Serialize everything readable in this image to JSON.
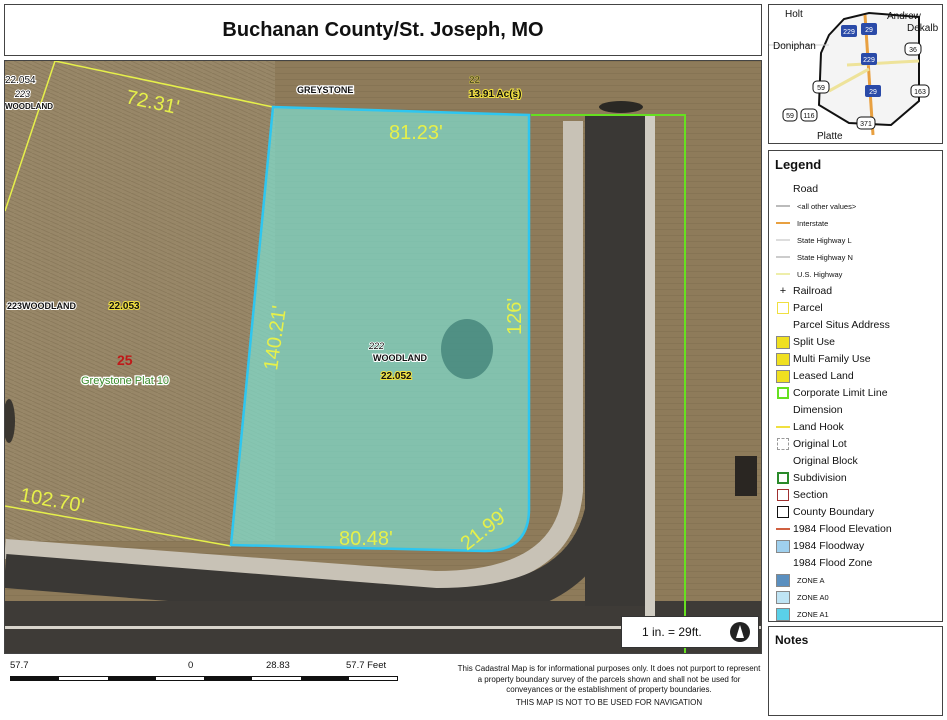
{
  "title": "Buchanan County/St. Joseph, MO",
  "map": {
    "labels": {
      "greystone": "GREYSTONE",
      "top_parcel_num": "22",
      "top_parcel_area": "13.91 Ac(s)",
      "left_top_id": "22.054",
      "left_top_num": "223",
      "left_top_street": "WOODLAND",
      "left_mid_addr": "223WOODLAND",
      "left_mid_id": "22.053",
      "section_num": "25",
      "plat": "Greystone Plat 10",
      "parcel_num": "222",
      "parcel_street": "WOODLAND",
      "parcel_id": "22.052"
    },
    "dimensions": {
      "top": "81.23'",
      "left": "140.21'",
      "right": "126'",
      "bottom": "80.48'",
      "corner": "21.99'",
      "top_left": "72.31'",
      "bottom_left": "102.70'"
    },
    "colors": {
      "selected_parcel": "#7fe0d0",
      "selected_outline": "#2ec6f0",
      "dimension_text": "#e6f04a",
      "limit_line": "#66e020"
    }
  },
  "scale": {
    "text": "1 in. = 29ft.",
    "north_icon": "north-arrow-icon"
  },
  "scalebar": {
    "labels": [
      "57.7",
      "0",
      "28.83",
      "57.7 Feet"
    ]
  },
  "disclaimer": {
    "text": "This Cadastral Map is for informational purposes only.  It does not purport to represent a property boundary survey of the parcels shown and shall not be used for conveyances or the establishment of property boundaries.",
    "warning": "THIS MAP IS NOT TO BE USED FOR NAVIGATION"
  },
  "inset": {
    "places": [
      "Holt",
      "Andrew",
      "Dekalb",
      "Doniphan",
      "Platte"
    ],
    "shields": [
      "229",
      "29",
      "36",
      "229",
      "59",
      "29",
      "163",
      "59",
      "116",
      "371"
    ]
  },
  "legend": {
    "title": "Legend",
    "items": [
      {
        "label": "Road",
        "symbol": "none",
        "color": ""
      },
      {
        "label": "<all other values>",
        "symbol": "line",
        "color": "#bbbbbb",
        "small": true
      },
      {
        "label": "Interstate",
        "symbol": "line",
        "color": "#e8a040",
        "small": true
      },
      {
        "label": "State Highway L",
        "symbol": "line",
        "color": "#dddddd",
        "small": true
      },
      {
        "label": "State Highway N",
        "symbol": "line",
        "color": "#cccccc",
        "small": true
      },
      {
        "label": "U.S. Highway",
        "symbol": "line",
        "color": "#eeeeaa",
        "small": true
      },
      {
        "label": "Railroad",
        "symbol": "rail",
        "color": "#111111"
      },
      {
        "label": "Parcel",
        "symbol": "outline",
        "color": "#f0e040"
      },
      {
        "label": "Parcel Situs Address",
        "symbol": "none",
        "color": ""
      },
      {
        "label": "Split Use",
        "symbol": "fill",
        "color": "#f0e020"
      },
      {
        "label": "Multi Family Use",
        "symbol": "fill",
        "color": "#f0e020"
      },
      {
        "label": "Leased Land",
        "symbol": "fill",
        "color": "#f0e020"
      },
      {
        "label": "Corporate Limit Line",
        "symbol": "outline-thick",
        "color": "#66e020"
      },
      {
        "label": "Dimension",
        "symbol": "none",
        "color": ""
      },
      {
        "label": "Land Hook",
        "symbol": "line",
        "color": "#f0e040"
      },
      {
        "label": "Original Lot",
        "symbol": "dashed",
        "color": "#999999"
      },
      {
        "label": "Original Block",
        "symbol": "none",
        "color": ""
      },
      {
        "label": "Subdivision",
        "symbol": "outline-thick",
        "color": "#2a8a2a"
      },
      {
        "label": "Section",
        "symbol": "outline",
        "color": "#a03030"
      },
      {
        "label": "County Boundary",
        "symbol": "outline",
        "color": "#111111"
      },
      {
        "label": "1984 Flood Elevation",
        "symbol": "line",
        "color": "#d06040"
      },
      {
        "label": "1984 Floodway",
        "symbol": "fill",
        "color": "#9fd0ee"
      },
      {
        "label": "1984 Flood Zone",
        "symbol": "none",
        "color": ""
      },
      {
        "label": "ZONE A",
        "symbol": "fill",
        "color": "#5a8fbf",
        "small": true
      },
      {
        "label": "ZONE A0",
        "symbol": "fill",
        "color": "#bfe4f4",
        "small": true
      },
      {
        "label": "ZONE A1",
        "symbol": "fill",
        "color": "#5ad0e8",
        "small": true
      }
    ]
  },
  "notes": {
    "title": "Notes"
  }
}
